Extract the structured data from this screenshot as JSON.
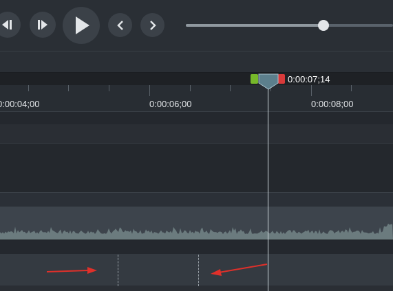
{
  "transport": {
    "buttons": [
      {
        "name": "step-back-button",
        "icon": "step-back-icon"
      },
      {
        "name": "step-forward-button",
        "icon": "step-forward-icon"
      },
      {
        "name": "play-button",
        "icon": "play-icon"
      },
      {
        "name": "previous-button",
        "icon": "chevron-left-icon"
      },
      {
        "name": "next-button",
        "icon": "chevron-right-icon"
      }
    ],
    "scrubber_progress": 0.74
  },
  "playhead": {
    "time": "0:00:07;14",
    "in_handle_color": "#76b82a",
    "out_handle_color": "#d93a3a",
    "head_color": "#5c7f8c"
  },
  "ruler": {
    "labels": [
      "0:00:04;00",
      "0:00:06;00",
      "0:00:08;00"
    ]
  },
  "annotations": {
    "arrow_color": "#e0302a"
  }
}
